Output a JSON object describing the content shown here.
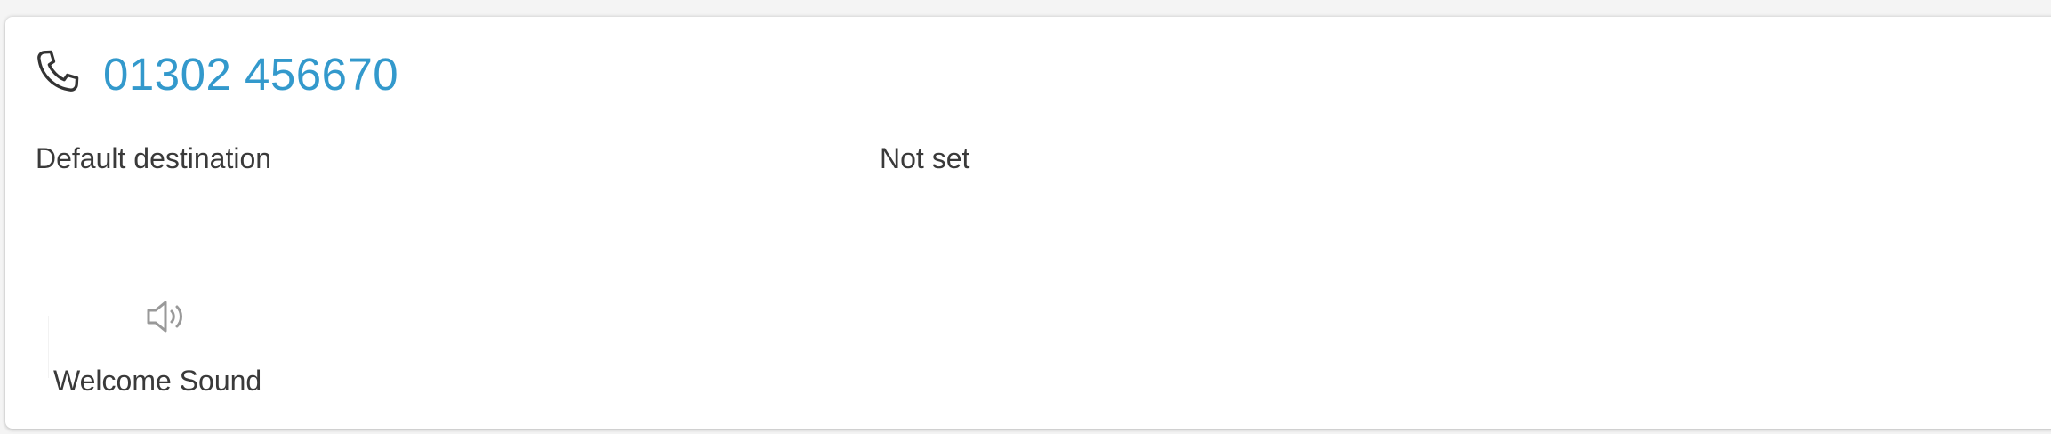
{
  "number": {
    "display": "01302 456670",
    "icon": "phone-icon",
    "color": "#3399cc"
  },
  "default_destination": {
    "label": "Default destination",
    "value": "Not set"
  },
  "welcome_sound": {
    "label": "Welcome Sound",
    "icon": "speaker-icon"
  }
}
